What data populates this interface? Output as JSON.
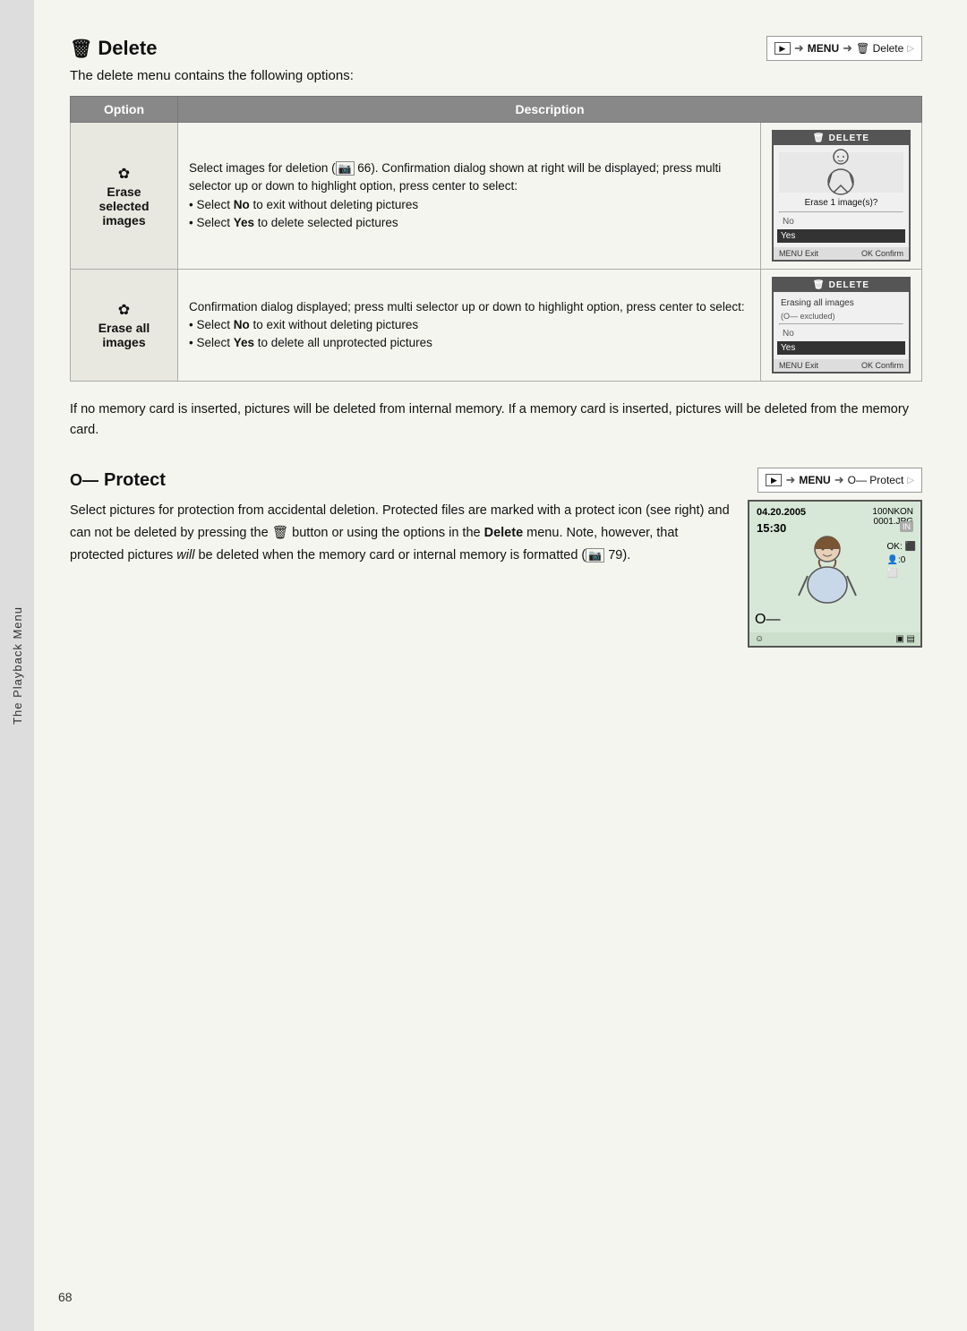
{
  "page": {
    "number": "68",
    "sidebar_label": "The Playback Menu"
  },
  "delete_section": {
    "title": "Delete",
    "trash_symbol": "🗑",
    "breadcrumb": {
      "play_btn": "▶",
      "arrow1": "➜",
      "menu_label": "MENU",
      "arrow2": "➜",
      "item_label": "🗑 Delete",
      "end_arrow": "▷"
    },
    "subtitle": "The delete menu contains the following options:",
    "table": {
      "col_option": "Option",
      "col_description": "Description",
      "rows": [
        {
          "option_icon": "✿",
          "option_label": "Erase\nselected\nimages",
          "description_parts": [
            "Select images for deletion (",
            "66",
            "). Confirmation dialog shown at right will be displayed; press multi selector up or down to highlight option, press center to select:",
            "• Select No to exit without deleting pictures",
            "• Select Yes to delete selected pictures"
          ],
          "screen": {
            "header": "DELETE",
            "image_alt": "person with camera",
            "line1": "Erase 1 image(s)?",
            "no_label": "No",
            "yes_label": "Yes",
            "footer_left": "MENU Exit",
            "footer_right": "OK Confirm"
          }
        },
        {
          "option_icon": "✿",
          "option_label": "Erase all\nimages",
          "description_parts": [
            "Confirmation dialog displayed; press multi selector up or down to highlight option, press center to select:",
            "• Select No to exit without deleting pictures",
            "• Select Yes to delete all unprotected pictures"
          ],
          "screen": {
            "header": "DELETE",
            "line1": "Erasing all images",
            "line2": "(O— excluded)",
            "no_label": "No",
            "yes_label": "Yes",
            "footer_left": "MENU Exit",
            "footer_right": "OK Confirm"
          }
        }
      ]
    },
    "info_text": "If no memory card is inserted, pictures will be deleted from internal memory. If a memory card is inserted, pictures will be deleted from the memory card."
  },
  "protect_section": {
    "title": "Protect",
    "key_symbol": "O—",
    "breadcrumb": {
      "play_btn": "▶",
      "arrow1": "➜",
      "menu_label": "MENU",
      "arrow2": "➜",
      "item_label": "O— Protect",
      "end_arrow": "▷"
    },
    "body_text": [
      "Select pictures for protection from accidental deletion.",
      "Protected files are marked with a protect icon (see right) and can not be deleted by pressing the 🗑 button or using the options in the Delete menu. Note, however, that protected pictures will be deleted when the memory card or internal memory is formatted (",
      "79",
      ")."
    ],
    "camera_screen": {
      "date": "04.20.2005",
      "time": "15:30",
      "folder": "100NKON\n0001.JPG",
      "in_label": "IN",
      "protect_icon": "O—",
      "ok_label": "OK:",
      "bottom_icons": "⬛⬛"
    }
  }
}
